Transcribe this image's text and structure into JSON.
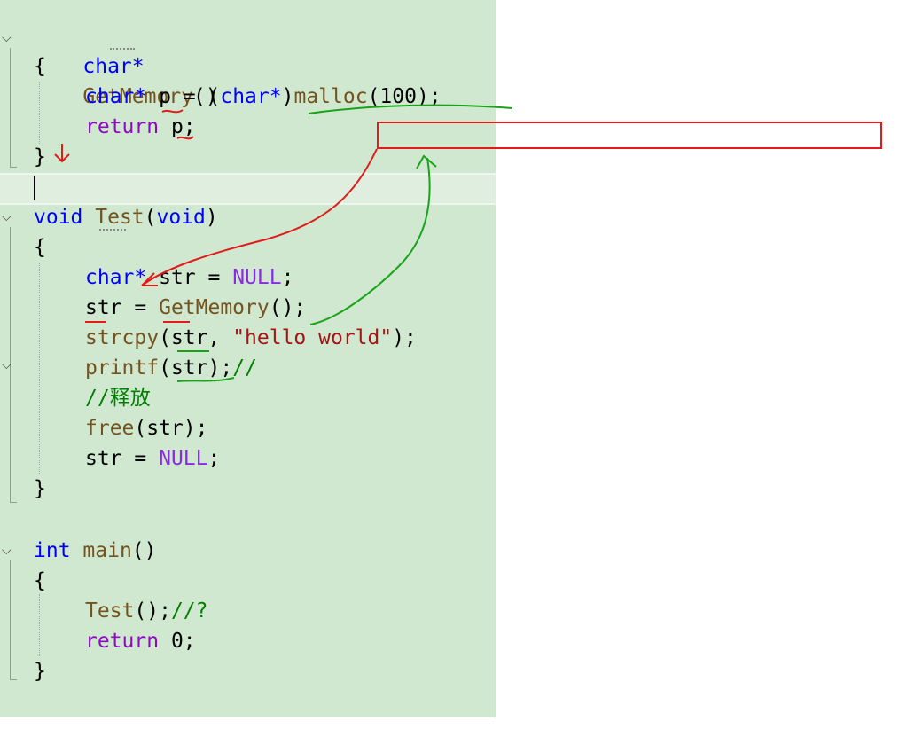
{
  "code": {
    "getmemory": {
      "sig_type": "char*",
      "sig_name": "GetMemory",
      "sig_parens": "()",
      "open_brace": "{",
      "line1_type": "char*",
      "line1_var": "p",
      "line1_eq": " = (",
      "line1_cast": "char*",
      "line1_close": ")",
      "line1_fn": "malloc",
      "line1_args": "(100);",
      "line2_kw": "return",
      "line2_rest": " p;",
      "close_brace": "}"
    },
    "test": {
      "sig_type": "void",
      "sig_name": "Test",
      "sig_open": "(",
      "sig_arg": "void",
      "sig_close": ")",
      "open_brace": "{",
      "l1_type": "char*",
      "l1_rest": " str = ",
      "l1_null": "NULL",
      "l1_end": ";",
      "l2_start": "str = ",
      "l2_fn": "GetMemory",
      "l2_end": "();",
      "l3_fn": "strcpy",
      "l3_mid": "(str, ",
      "l3_str": "\"hello world\"",
      "l3_end": ");",
      "l4_fn": "printf",
      "l4_mid": "(str);",
      "l4_comment": "//",
      "l5_comment": "//释放",
      "l6_fn": "free",
      "l6_rest": "(str);",
      "l7_start": "str = ",
      "l7_null": "NULL",
      "l7_end": ";",
      "close_brace": "}"
    },
    "main": {
      "sig_type": "int",
      "sig_name": "main",
      "sig_parens": "()",
      "open_brace": "{",
      "l1_fn": "Test",
      "l1_rest": "();",
      "l1_comment": "//?",
      "l2_kw": "return",
      "l2_rest": " 0;",
      "close_brace": "}"
    }
  },
  "colors": {
    "editor_bg": "#cfe8cf",
    "keyword": "#0000ff",
    "function": "#74531f",
    "macro": "#8a2be2",
    "string": "#a31515",
    "comment": "#008000",
    "annotation_red": "#e31a1a",
    "annotation_green": "#1aa31a"
  },
  "icons": [
    "chevron-down-icon"
  ]
}
